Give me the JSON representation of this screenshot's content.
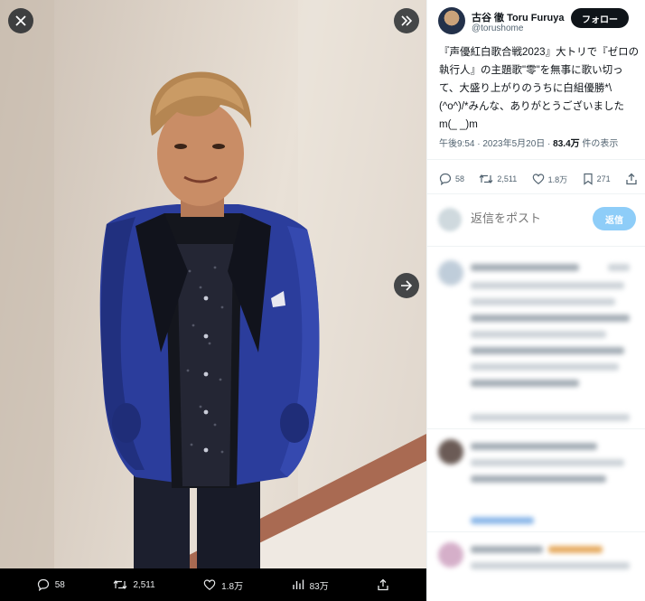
{
  "viewer": {
    "actions": [
      {
        "icon": "reply-icon",
        "count": "58"
      },
      {
        "icon": "retweet-icon",
        "count": "2,511"
      },
      {
        "icon": "like-icon",
        "count": "1.8万"
      },
      {
        "icon": "views-icon",
        "count": "83万"
      },
      {
        "icon": "share-icon",
        "count": ""
      }
    ]
  },
  "tweet": {
    "display_name": "古谷 徹 Toru Furuya",
    "handle": "@torushome",
    "follow_label": "フォロー",
    "text": "『声優紅白歌合戦2023』大トリで『ゼロの執行人』の主題歌\"零\"を無事に歌い切って、大盛り上がりのうちに白組優勝*\\(^o^)/*みんな、ありがとうございましたm(_ _)m",
    "time": "午後9:54 · 2023年5月20日 · ",
    "views": "83.4万",
    "views_suffix": " 件の表示",
    "actions": {
      "replies": "58",
      "retweets": "2,511",
      "likes": "1.8万",
      "bookmarks": "271"
    }
  },
  "reply_box": {
    "placeholder": "返信をポスト",
    "button": "返信"
  },
  "colors": {
    "jacket": "#2b3d9c",
    "accent_blue": "#1d9bf0",
    "reply_button": "#8ecdf8"
  }
}
